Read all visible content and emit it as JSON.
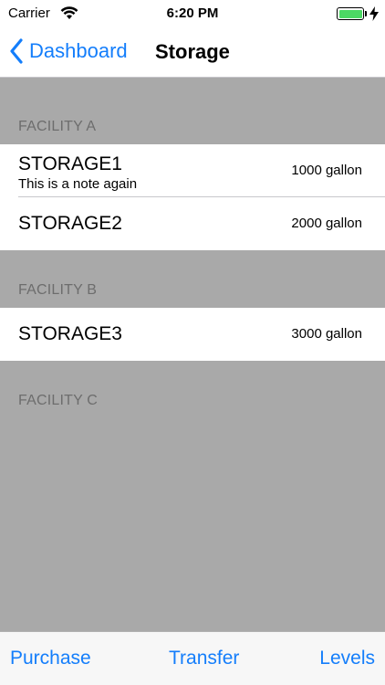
{
  "status_bar": {
    "carrier": "Carrier",
    "time": "6:20 PM",
    "battery_level": 1.0,
    "battery_color": "#4cd964"
  },
  "nav": {
    "back_label": "Dashboard",
    "title": "Storage",
    "accent_color": "#147efb"
  },
  "sections": [
    {
      "header": "FACILITY A",
      "rows": [
        {
          "title": "STORAGE1",
          "note": "This is a note again",
          "value": "1000 gallon"
        },
        {
          "title": "STORAGE2",
          "note": "",
          "value": "2000 gallon"
        }
      ]
    },
    {
      "header": "FACILITY B",
      "rows": [
        {
          "title": "STORAGE3",
          "note": "",
          "value": "3000 gallon"
        }
      ]
    },
    {
      "header": "FACILITY C",
      "rows": []
    }
  ],
  "toolbar": {
    "purchase_label": "Purchase",
    "transfer_label": "Transfer",
    "levels_label": "Levels"
  },
  "icons": [
    "wifi-icon",
    "battery-icon",
    "charging-bolt-icon",
    "back-chevron-icon"
  ]
}
